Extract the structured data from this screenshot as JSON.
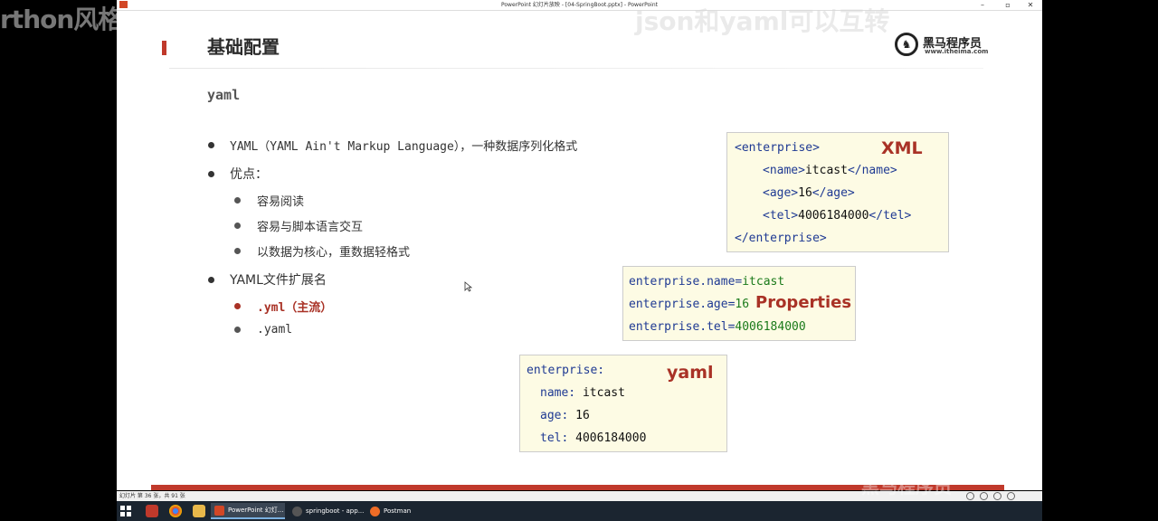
{
  "overlays": {
    "left_text": "rthon风格",
    "right_text": "json和yaml可以互转",
    "bottom_right_text": "黑马程序员"
  },
  "window": {
    "title": "PowerPoint 幻灯片放映 - [04-SpringBoot.pptx] - PowerPoint",
    "min_glyph": "–",
    "max_glyph": "▫",
    "close_glyph": "✕"
  },
  "slide": {
    "title": "基础配置",
    "subtitle": "yaml",
    "logo": {
      "name": "黑马程序员",
      "url": "www.itheima.com"
    },
    "bullets": {
      "b1": "YAML（YAML Ain't Markup Language），一种数据序列化格式",
      "b2": "优点：",
      "b2_items": [
        "容易阅读",
        "容易与脚本语言交互",
        "以数据为核心，重数据轻格式"
      ],
      "b3": "YAML文件扩展名",
      "b3_items": [
        ".yml（主流）",
        ".yaml"
      ]
    },
    "xml_box": {
      "label": "XML",
      "lines": {
        "l1": "<enterprise>",
        "l2_open": "<name>",
        "l2_val": "itcast",
        "l2_close": "</name>",
        "l3_open": "<age>",
        "l3_val": "16",
        "l3_close": "</age>",
        "l4_open": "<tel>",
        "l4_val": "4006184000",
        "l4_close": "</tel>",
        "l5": "</enterprise>"
      }
    },
    "props_box": {
      "label": "Properties",
      "lines": [
        {
          "key": "enterprise.name=",
          "val": "itcast"
        },
        {
          "key": "enterprise.age=",
          "val": "16"
        },
        {
          "key": "enterprise.tel=",
          "val": "4006184000"
        }
      ]
    },
    "yaml_box": {
      "label": "yaml",
      "lines": {
        "root": "enterprise:",
        "name_key": "name:",
        "name_val": "itcast",
        "age_key": "age:",
        "age_val": "16",
        "tel_key": "tel:",
        "tel_val": "4006184000"
      }
    }
  },
  "statusbar": {
    "text": "幻灯片 第 36 张，共 91 张"
  },
  "taskbar": {
    "apps": [
      {
        "label": "PowerPoint 幻灯..."
      },
      {
        "label": "springboot - app..."
      },
      {
        "label": "Postman"
      }
    ]
  }
}
